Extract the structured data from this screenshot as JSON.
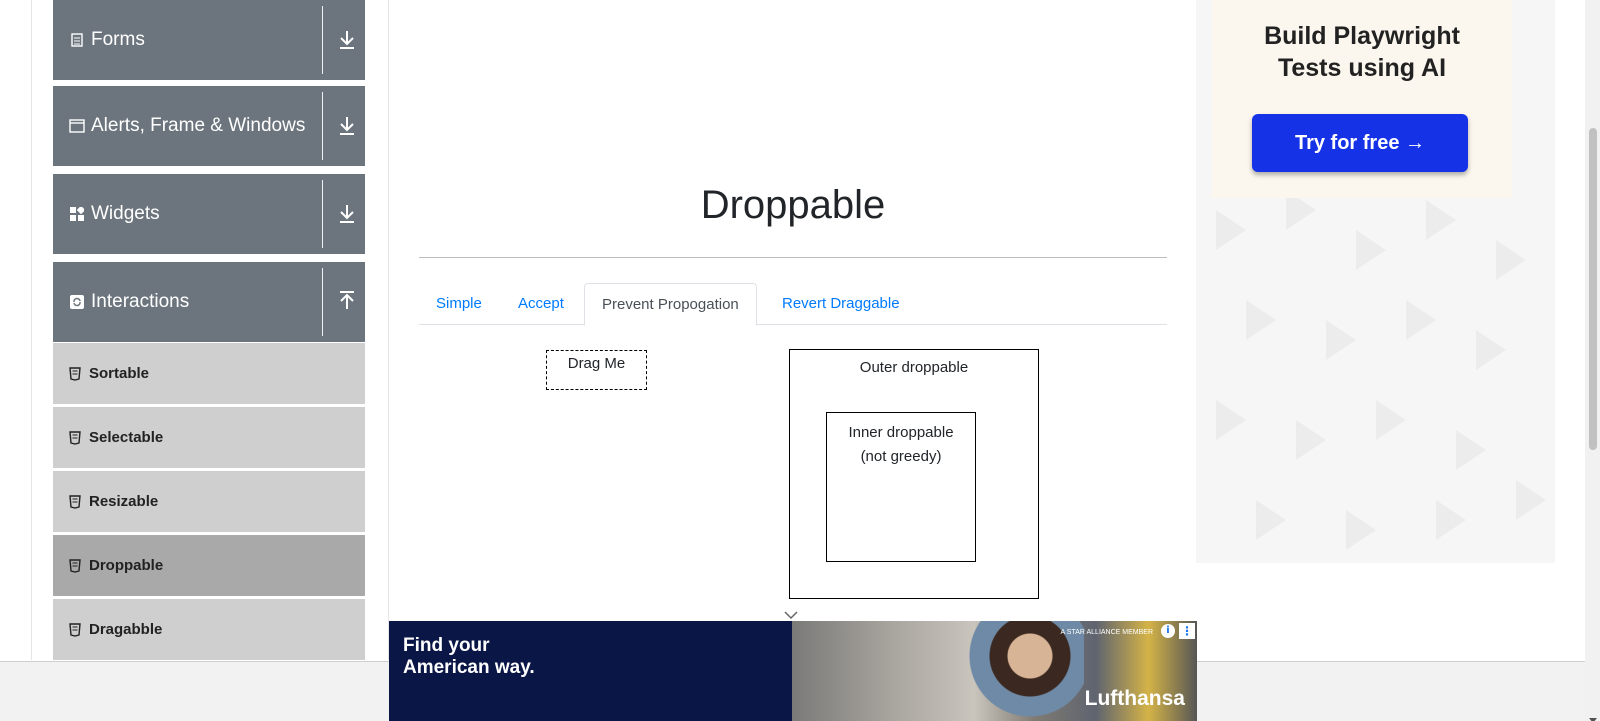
{
  "sidebar": {
    "groups": [
      {
        "label": "Forms",
        "icon": "document-icon",
        "arrow": "download-icon"
      },
      {
        "label": "Alerts, Frame & Windows",
        "icon": "window-icon",
        "arrow": "download-icon"
      },
      {
        "label": "Widgets",
        "icon": "grid-icon",
        "arrow": "download-icon"
      },
      {
        "label": "Interactions",
        "icon": "refresh-icon",
        "arrow": "upload-icon"
      }
    ],
    "items": [
      {
        "label": "Sortable"
      },
      {
        "label": "Selectable"
      },
      {
        "label": "Resizable"
      },
      {
        "label": "Droppable",
        "active": true
      },
      {
        "label": "Dragabble"
      }
    ]
  },
  "main": {
    "title": "Droppable",
    "tabs": [
      {
        "label": "Simple"
      },
      {
        "label": "Accept"
      },
      {
        "label": "Prevent Propogation",
        "active": true
      },
      {
        "label": "Revert Draggable"
      }
    ],
    "drag_label": "Drag Me",
    "outer_label": "Outer droppable",
    "inner_label_line1": "Inner droppable",
    "inner_label_line2": "(not greedy)"
  },
  "right_ad": {
    "headline_line1": "Build Playwright",
    "headline_line2": "Tests using AI",
    "button_label": "Try for free →"
  },
  "bottom_ad": {
    "line1": "Find your",
    "line2": "American way.",
    "brand": "Lufthansa",
    "tiny_text": "A STAR ALLIANCE MEMBER",
    "info_glyph": "i",
    "menu_glyph": "⋮"
  },
  "colors": {
    "sidebar_group": "#6c757d",
    "sidebar_item": "#cfcfcf",
    "sidebar_item_active": "#a9a9a9",
    "tab_link": "#007bff",
    "ad_button": "#1532e6",
    "ad_navy": "#0a1646"
  }
}
